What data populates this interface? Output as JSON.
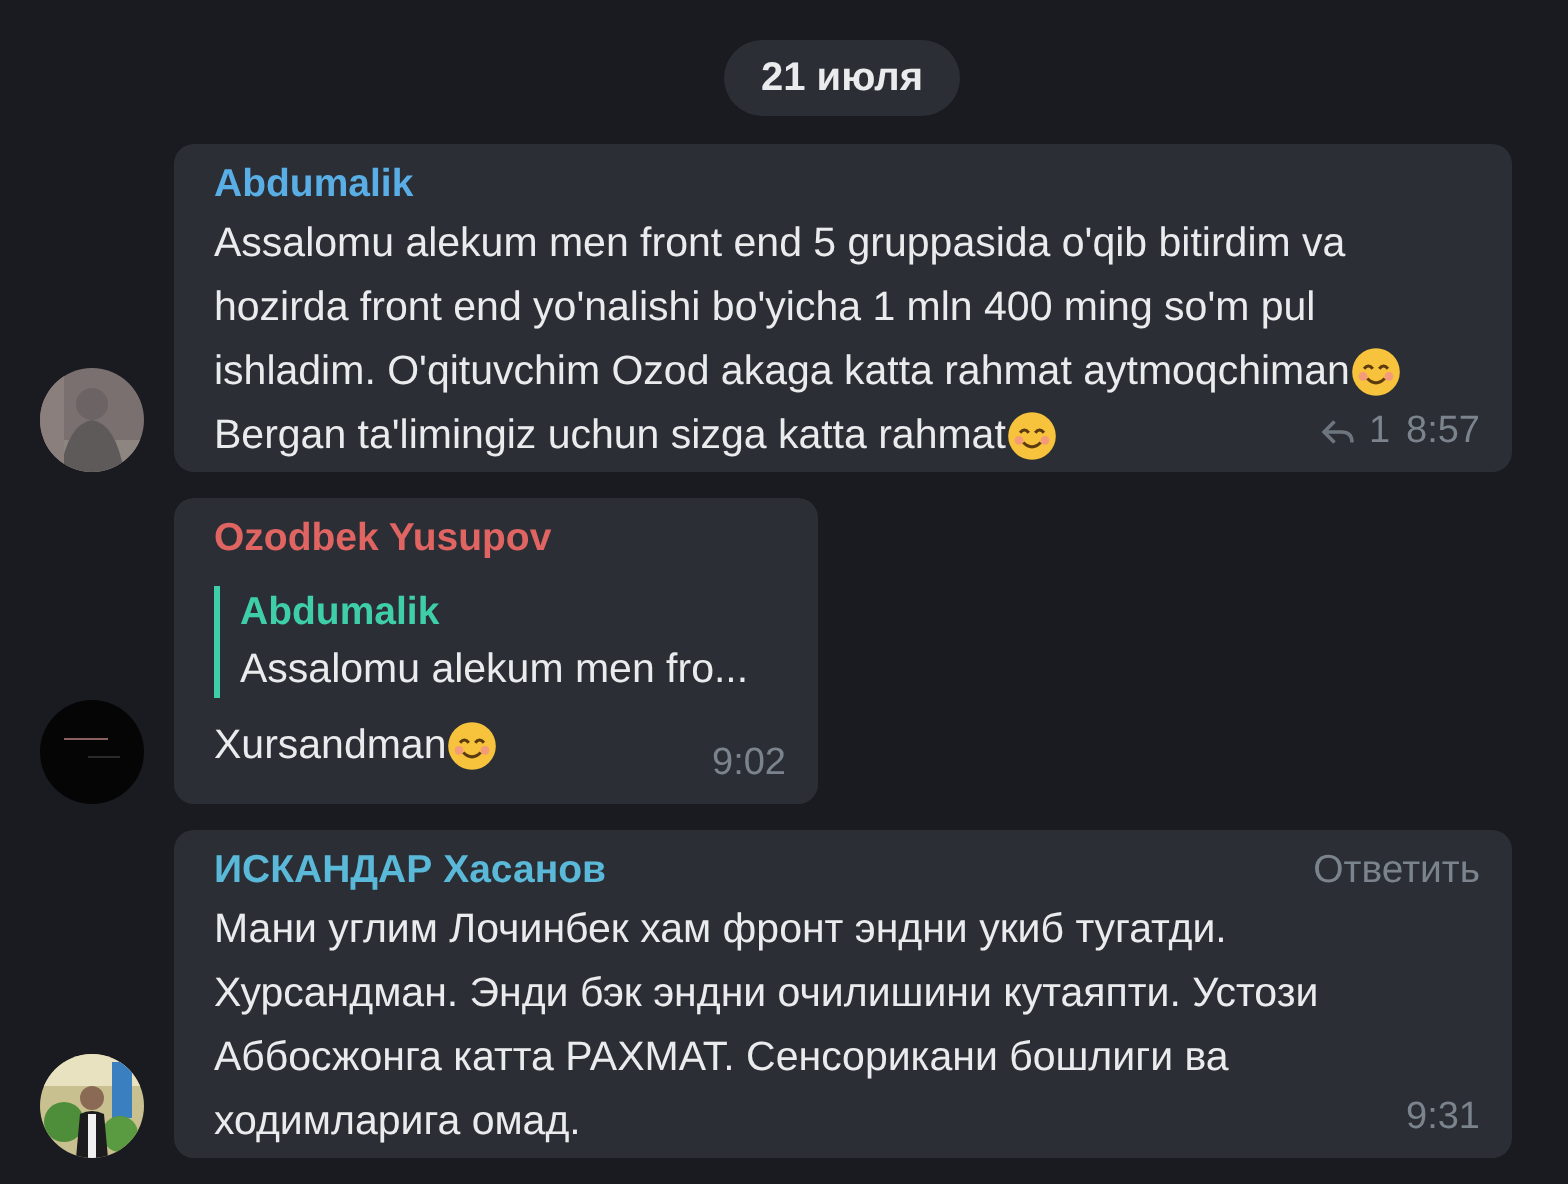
{
  "date_separator": "21 июля",
  "messages": [
    {
      "sender": "Abdumalik",
      "color": "#5aaee6",
      "lines": [
        {
          "text": "Assalomu alekum men front end 5 gruppasida o'qib bitirdim va",
          "emoji": false
        },
        {
          "text": "hozirda front end yo'nalishi bo'yicha 1 mln 400 ming so'm pul",
          "emoji": false
        },
        {
          "text": "ishladim. O'qituvchim Ozod akaga katta rahmat aytmoqchiman",
          "emoji": true
        },
        {
          "text": "Bergan ta'limingiz uchun sizga katta rahmat",
          "emoji": true
        }
      ],
      "replies": "1",
      "time": "8:57"
    },
    {
      "sender": "Ozodbek Yusupov",
      "color": "#e06461",
      "quote": {
        "sender": "Abdumalik",
        "text": "Assalomu alekum men fro..."
      },
      "lines": [
        {
          "text": "Xursandman",
          "emoji": true
        }
      ],
      "time": "9:02"
    },
    {
      "sender": "ИСКАНДАР Хасанов",
      "color": "#5ab8d8",
      "reply_action": "Ответить",
      "lines": [
        {
          "text": "Мани углим Лочинбек хам фронт эндни укиб тугатди.",
          "emoji": false
        },
        {
          "text": "Хурсандман. Энди бэк эндни очилишини кутаяпти. Устози",
          "emoji": false
        },
        {
          "text": "Аббосжонга катта РАХМАТ. Сенсорикани бошлиги ва",
          "emoji": false
        },
        {
          "text": "ходимларига омад.",
          "emoji": false
        }
      ],
      "time": "9:31"
    }
  ]
}
